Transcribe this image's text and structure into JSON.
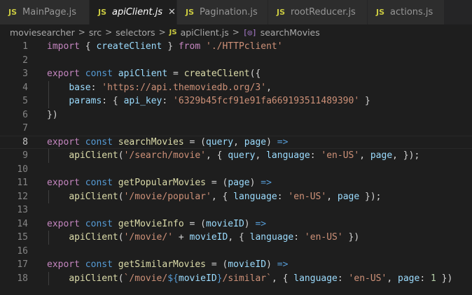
{
  "tabs": [
    {
      "icon": "JS",
      "label": "MainPage.js",
      "active": false
    },
    {
      "icon": "JS",
      "label": "apiClient.js",
      "active": true,
      "close": "✕"
    },
    {
      "icon": "JS",
      "label": "Pagination.js",
      "active": false
    },
    {
      "icon": "JS",
      "label": "rootReducer.js",
      "active": false
    },
    {
      "icon": "JS",
      "label": "actions.js",
      "active": false
    }
  ],
  "breadcrumb": {
    "parts": [
      "moviesearcher",
      "src",
      "selectors"
    ],
    "file_icon": "JS",
    "file": "apiClient.js",
    "symbol_icon": "[◎]",
    "symbol": "searchMovies",
    "separator": ">"
  },
  "editor": {
    "current_line": 8,
    "lines": [
      {
        "n": "1",
        "tokens": [
          [
            "kw2",
            "import"
          ],
          [
            "op",
            " { "
          ],
          [
            "var",
            "createClient"
          ],
          [
            "op",
            " } "
          ],
          [
            "kw2",
            "from"
          ],
          [
            "op",
            " "
          ],
          [
            "str",
            "'./HTTPclient'"
          ]
        ]
      },
      {
        "n": "2",
        "tokens": []
      },
      {
        "n": "3",
        "tokens": [
          [
            "kw2",
            "export"
          ],
          [
            "op",
            " "
          ],
          [
            "kw",
            "const"
          ],
          [
            "op",
            " "
          ],
          [
            "var",
            "apiClient"
          ],
          [
            "op",
            " = "
          ],
          [
            "fn",
            "createClient"
          ],
          [
            "op",
            "({"
          ]
        ]
      },
      {
        "n": "4",
        "tokens": [
          [
            "op",
            "    "
          ],
          [
            "var",
            "base"
          ],
          [
            "op",
            ": "
          ],
          [
            "str",
            "'https://api.themoviedb.org/3'"
          ],
          [
            "op",
            ","
          ]
        ]
      },
      {
        "n": "5",
        "tokens": [
          [
            "op",
            "    "
          ],
          [
            "var",
            "params"
          ],
          [
            "op",
            ": { "
          ],
          [
            "var",
            "api_key"
          ],
          [
            "op",
            ": "
          ],
          [
            "str",
            "'6329b45fcf91e91fa669193511489390'"
          ],
          [
            "op",
            " }"
          ]
        ]
      },
      {
        "n": "6",
        "tokens": [
          [
            "op",
            "})"
          ]
        ]
      },
      {
        "n": "7",
        "tokens": []
      },
      {
        "n": "8",
        "tokens": [
          [
            "kw2",
            "export"
          ],
          [
            "op",
            " "
          ],
          [
            "kw",
            "const"
          ],
          [
            "op",
            " "
          ],
          [
            "fn",
            "searchMovies"
          ],
          [
            "op",
            " = ("
          ],
          [
            "var",
            "query"
          ],
          [
            "op",
            ", "
          ],
          [
            "var",
            "page"
          ],
          [
            "op",
            ") "
          ],
          [
            "kw",
            "=>"
          ]
        ]
      },
      {
        "n": "9",
        "tokens": [
          [
            "op",
            "    "
          ],
          [
            "fn",
            "apiClient"
          ],
          [
            "op",
            "("
          ],
          [
            "str",
            "'/search/movie'"
          ],
          [
            "op",
            ", { "
          ],
          [
            "var",
            "query"
          ],
          [
            "op",
            ", "
          ],
          [
            "var",
            "language"
          ],
          [
            "op",
            ": "
          ],
          [
            "str",
            "'en-US'"
          ],
          [
            "op",
            ", "
          ],
          [
            "var",
            "page"
          ],
          [
            "op",
            ", });"
          ]
        ]
      },
      {
        "n": "10",
        "tokens": []
      },
      {
        "n": "11",
        "tokens": [
          [
            "kw2",
            "export"
          ],
          [
            "op",
            " "
          ],
          [
            "kw",
            "const"
          ],
          [
            "op",
            " "
          ],
          [
            "fn",
            "getPopularMovies"
          ],
          [
            "op",
            " = ("
          ],
          [
            "var",
            "page"
          ],
          [
            "op",
            ") "
          ],
          [
            "kw",
            "=>"
          ]
        ]
      },
      {
        "n": "12",
        "tokens": [
          [
            "op",
            "    "
          ],
          [
            "fn",
            "apiClient"
          ],
          [
            "op",
            "("
          ],
          [
            "str",
            "'/movie/popular'"
          ],
          [
            "op",
            ", { "
          ],
          [
            "var",
            "language"
          ],
          [
            "op",
            ": "
          ],
          [
            "str",
            "'en-US'"
          ],
          [
            "op",
            ", "
          ],
          [
            "var",
            "page"
          ],
          [
            "op",
            " });"
          ]
        ]
      },
      {
        "n": "13",
        "tokens": []
      },
      {
        "n": "14",
        "tokens": [
          [
            "kw2",
            "export"
          ],
          [
            "op",
            " "
          ],
          [
            "kw",
            "const"
          ],
          [
            "op",
            " "
          ],
          [
            "fn",
            "getMovieInfo"
          ],
          [
            "op",
            " = ("
          ],
          [
            "var",
            "movieID"
          ],
          [
            "op",
            ") "
          ],
          [
            "kw",
            "=>"
          ]
        ]
      },
      {
        "n": "15",
        "tokens": [
          [
            "op",
            "    "
          ],
          [
            "fn",
            "apiClient"
          ],
          [
            "op",
            "("
          ],
          [
            "str",
            "'/movie/'"
          ],
          [
            "op",
            " + "
          ],
          [
            "var",
            "movieID"
          ],
          [
            "op",
            ", { "
          ],
          [
            "var",
            "language"
          ],
          [
            "op",
            ": "
          ],
          [
            "str",
            "'en-US'"
          ],
          [
            "op",
            " })"
          ]
        ]
      },
      {
        "n": "16",
        "tokens": []
      },
      {
        "n": "17",
        "tokens": [
          [
            "kw2",
            "export"
          ],
          [
            "op",
            " "
          ],
          [
            "kw",
            "const"
          ],
          [
            "op",
            " "
          ],
          [
            "fn",
            "getSimilarMovies"
          ],
          [
            "op",
            " = ("
          ],
          [
            "var",
            "movieID"
          ],
          [
            "op",
            ") "
          ],
          [
            "kw",
            "=>"
          ]
        ]
      },
      {
        "n": "18",
        "tokens": [
          [
            "op",
            "    "
          ],
          [
            "fn",
            "apiClient"
          ],
          [
            "op",
            "("
          ],
          [
            "str",
            "`/movie/"
          ],
          [
            "tmpl",
            "${"
          ],
          [
            "var",
            "movieID"
          ],
          [
            "tmpl",
            "}"
          ],
          [
            "str",
            "/similar`"
          ],
          [
            "op",
            ", { "
          ],
          [
            "var",
            "language"
          ],
          [
            "op",
            ": "
          ],
          [
            "str",
            "'en-US'"
          ],
          [
            "op",
            ", "
          ],
          [
            "var",
            "page"
          ],
          [
            "op",
            ": "
          ],
          [
            "num",
            "1"
          ],
          [
            "op",
            " })"
          ]
        ]
      }
    ]
  }
}
